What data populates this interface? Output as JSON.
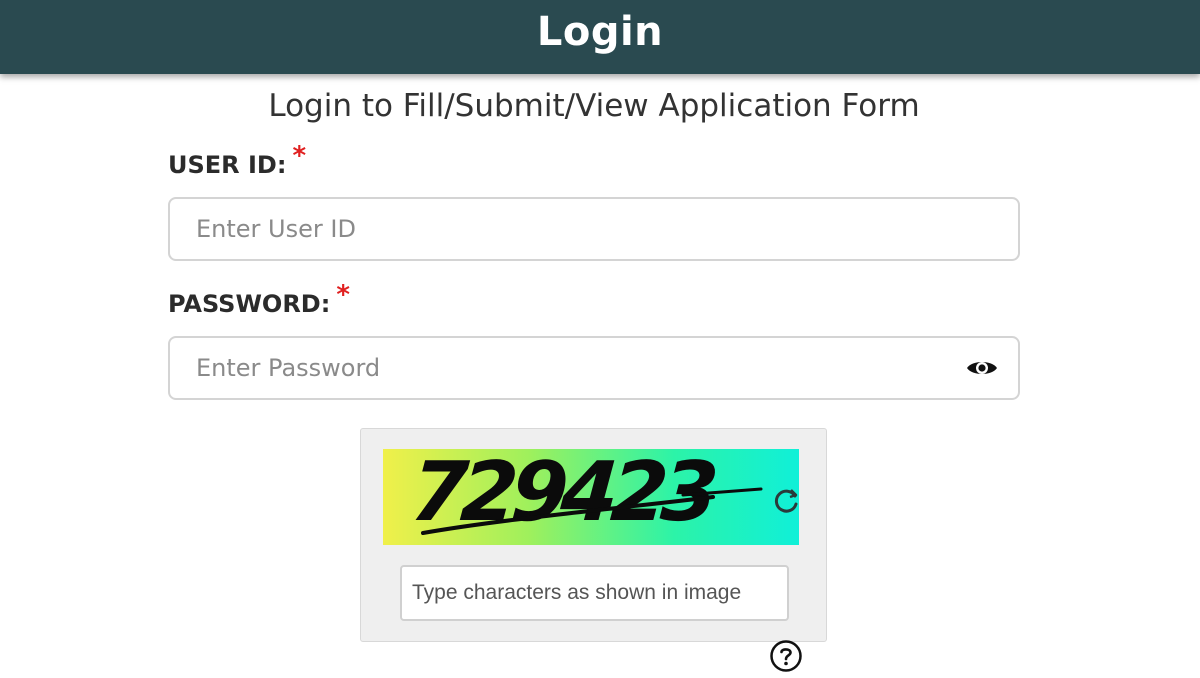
{
  "header": {
    "title": "Login"
  },
  "form": {
    "subtitle": "Login to Fill/Submit/View Application Form",
    "user_id": {
      "label": "USER ID:",
      "required_mark": "*",
      "placeholder": "Enter User ID",
      "value": ""
    },
    "password": {
      "label": "PASSWORD:",
      "required_mark": "*",
      "placeholder": "Enter Password",
      "value": "",
      "toggle_icon": "eye-icon"
    }
  },
  "captcha": {
    "code": "729423",
    "input_placeholder": "Type characters as shown in image",
    "input_value": "",
    "refresh_icon": "refresh-icon",
    "help_icon": "question-circle-icon"
  },
  "colors": {
    "header_bg": "#2a4a50",
    "header_text": "#ffffff",
    "required": "#e02020",
    "captcha_gradient_start": "#f0f04a",
    "captcha_gradient_end": "#10f0d8"
  }
}
